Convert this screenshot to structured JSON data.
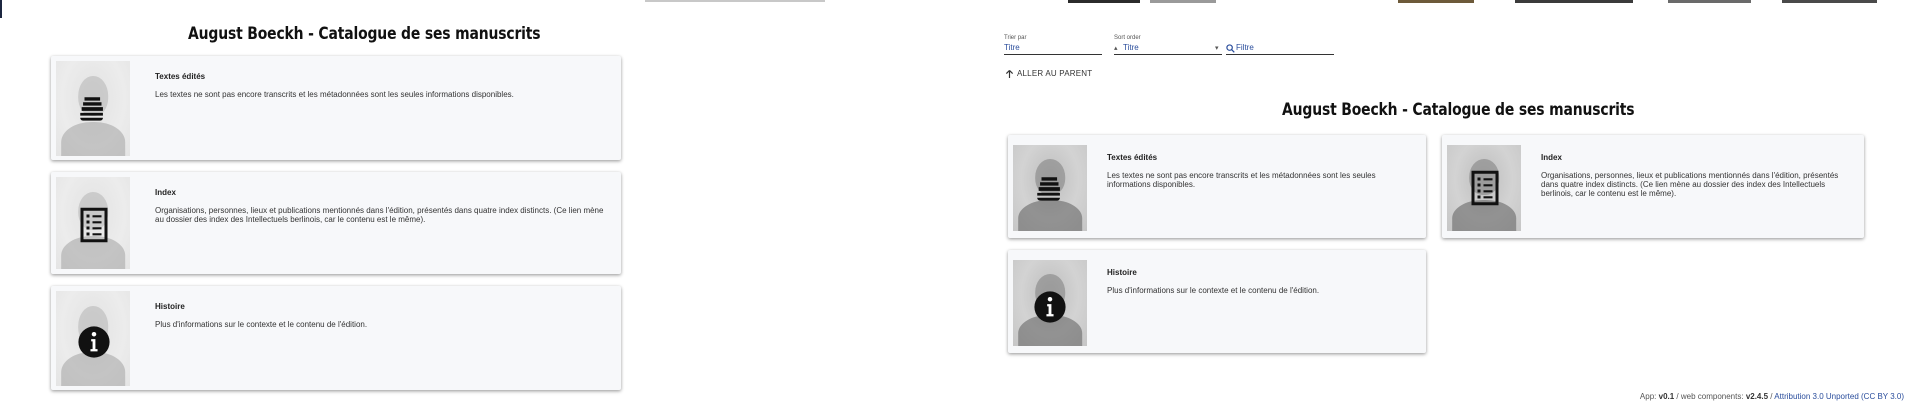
{
  "catalogue": {
    "title": "August Boeckh - Catalogue de ses manuscrits",
    "cards": [
      {
        "heading": "Textes édités",
        "text": "Les textes ne sont pas encore transcrits et les métadonnées sont les seules informations disponibles.",
        "icon": "books-icon"
      },
      {
        "heading": "Index",
        "text": "Organisations, personnes, lieux et publications mentionnés dans l'édition, présentés dans quatre index distincts. (Ce lien mène au dossier des index des Intellectuels berlinois, car le contenu est le même).",
        "icon": "list-icon"
      },
      {
        "heading": "Histoire",
        "text": "Plus d'informations sur le contexte et le contenu de l'édition.",
        "icon": "info-icon"
      }
    ]
  },
  "controls": {
    "sort_label": "Trier par",
    "sort_value": "Titre",
    "order_label": "Sort order",
    "order_value": "Titre",
    "filter_placeholder": "Filtre",
    "parent_link": "Aller au parent"
  },
  "footer": {
    "app_label": "App:",
    "app_version": "v0.1",
    "components_label": "web components:",
    "components_version": "v2.4.5",
    "license": "Attribution 3.0 Unported (CC BY 3.0)"
  },
  "colors": {
    "card_background": "#f7f8fa",
    "link": "#2a4d9c",
    "title": "#111111"
  }
}
